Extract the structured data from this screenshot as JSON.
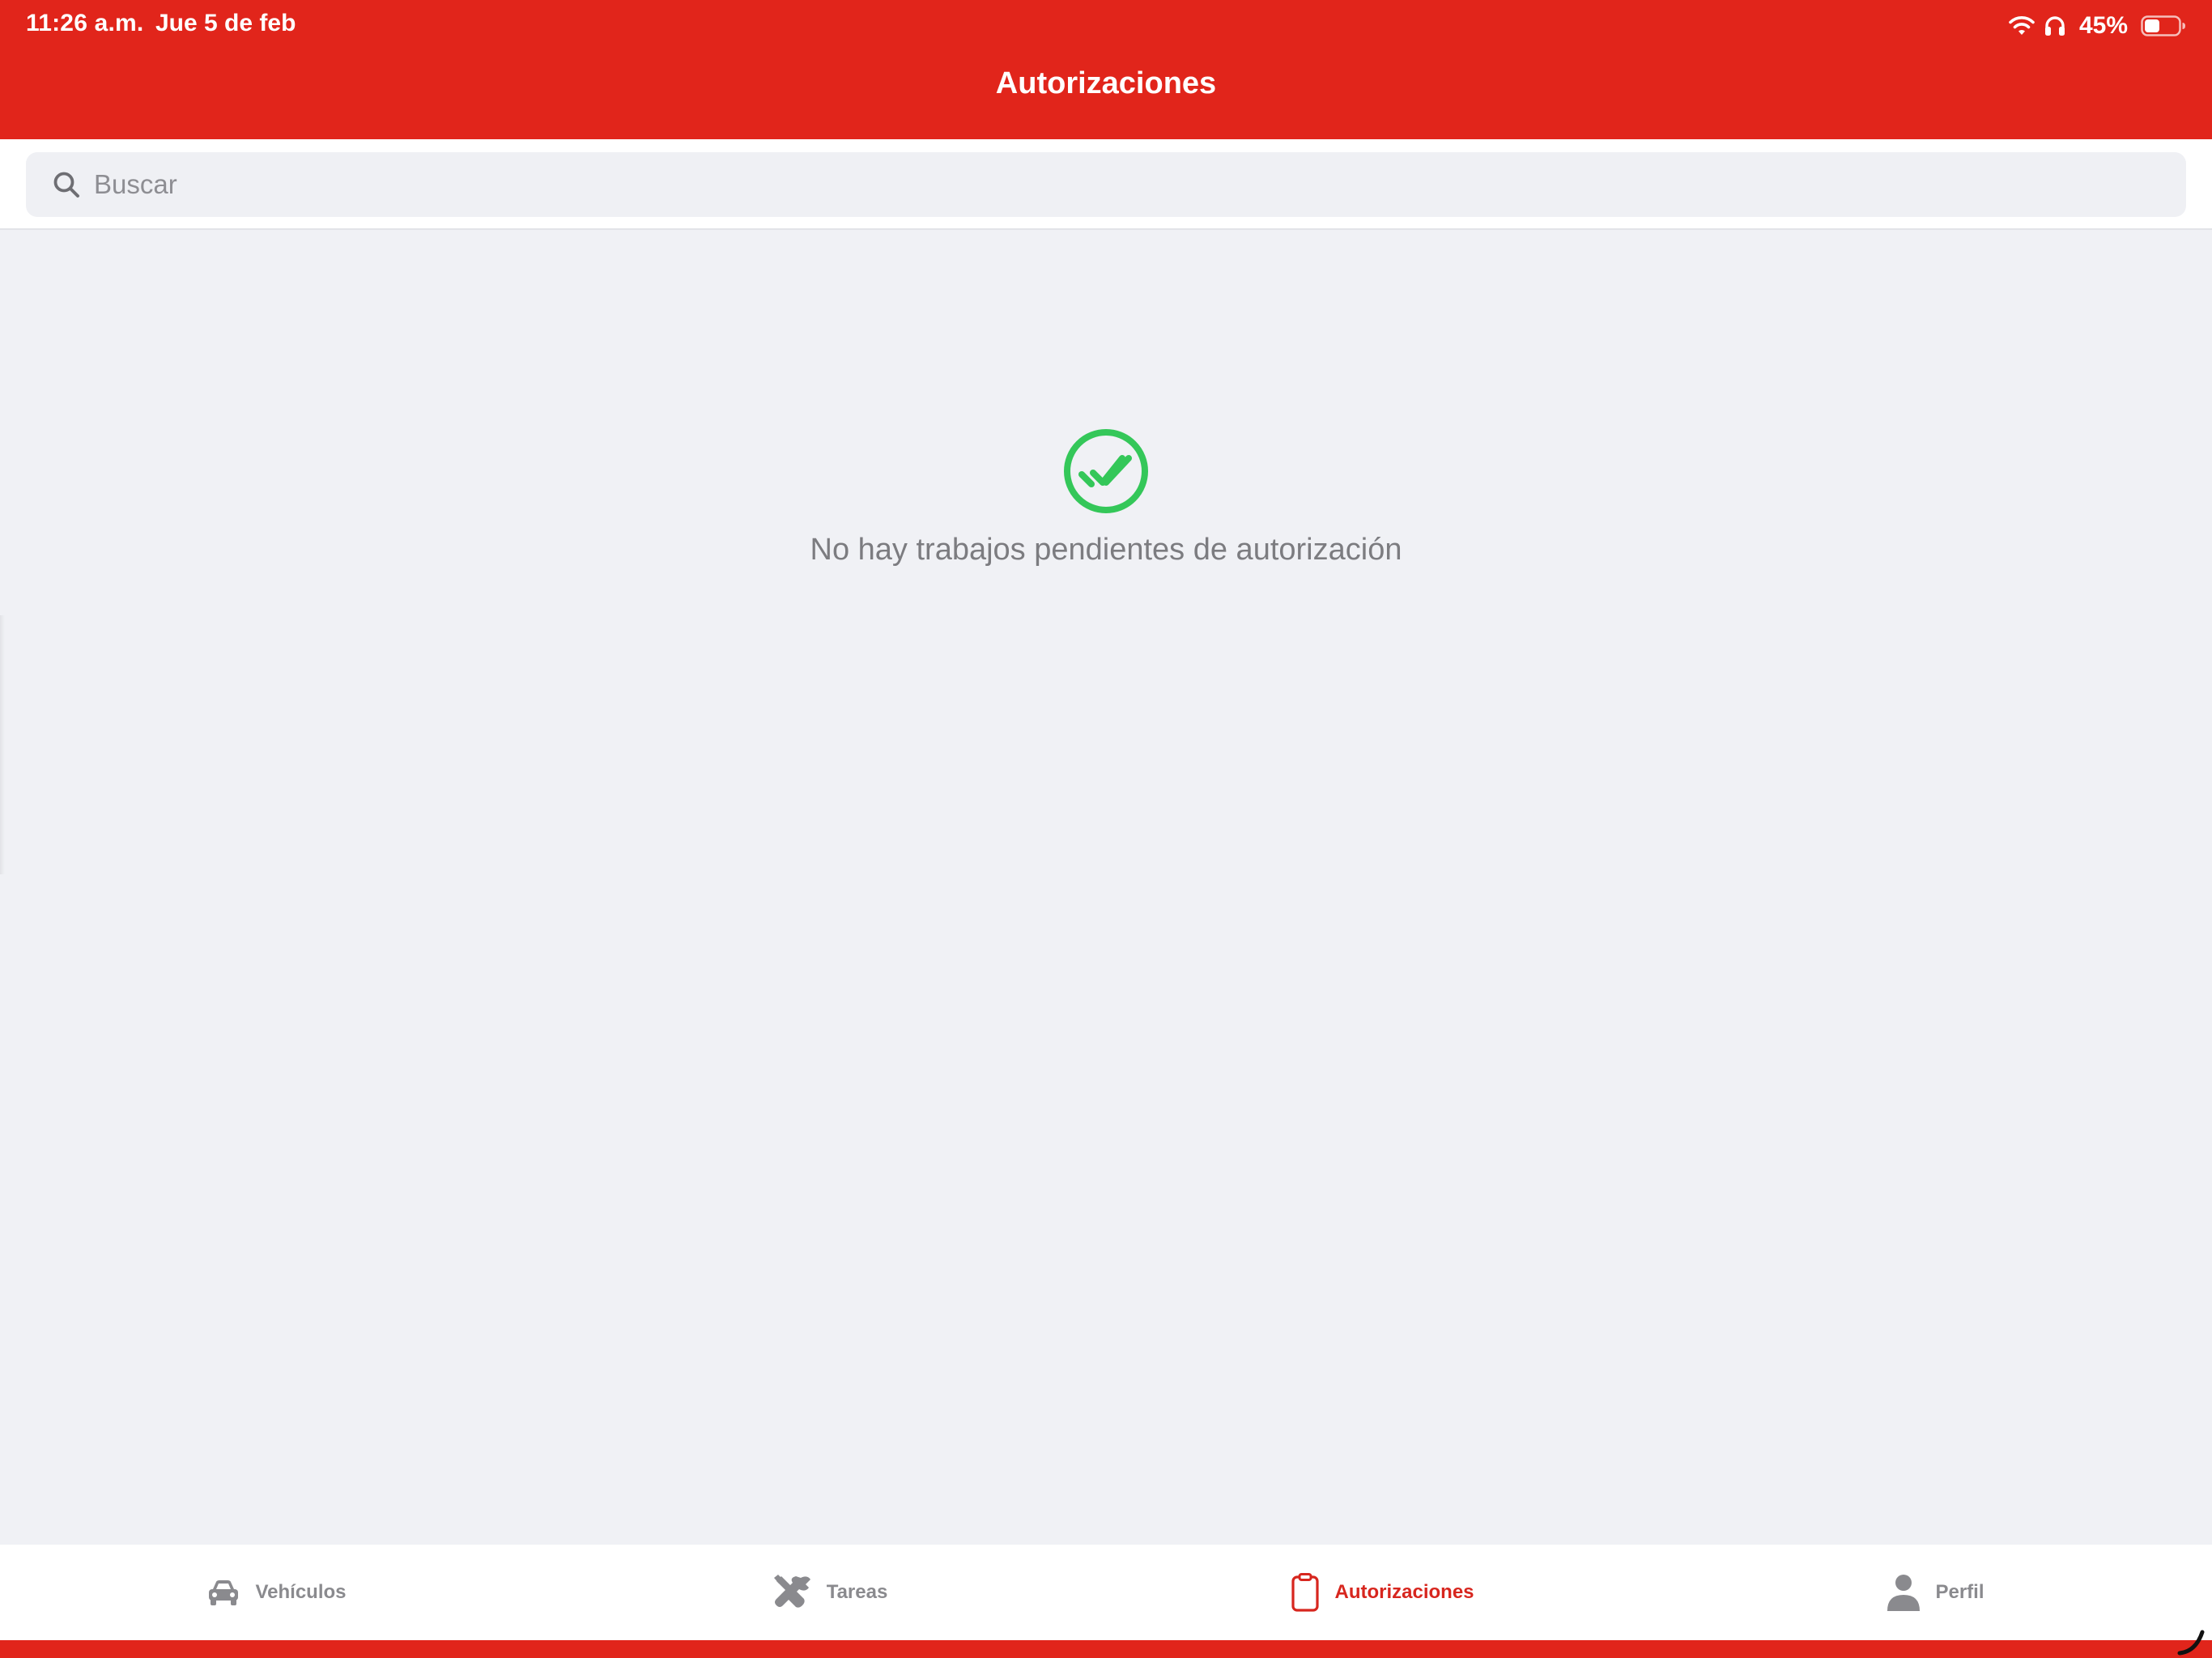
{
  "status_bar": {
    "time": "11:26 a.m.",
    "date": "Jue 5 de feb",
    "battery": "45%",
    "icons": [
      "wifi-icon",
      "headphones-icon",
      "battery-icon"
    ]
  },
  "header": {
    "title": "Autorizaciones"
  },
  "search": {
    "placeholder": "Buscar",
    "value": ""
  },
  "empty_state": {
    "icon": "double-check-circle-icon",
    "message": "No hay trabajos pendientes de autorización"
  },
  "tabs": [
    {
      "label": "Vehículos",
      "icon": "car-icon",
      "active": false
    },
    {
      "label": "Tareas",
      "icon": "tools-icon",
      "active": false
    },
    {
      "label": "Autorizaciones",
      "icon": "clipboard-icon",
      "active": true
    },
    {
      "label": "Perfil",
      "icon": "person-icon",
      "active": false
    }
  ],
  "colors": {
    "brand": "#e1251b",
    "active_tab": "#d7261e",
    "inactive_tab": "#8a8a8e",
    "success": "#34c759",
    "background": "#f0f1f5"
  }
}
